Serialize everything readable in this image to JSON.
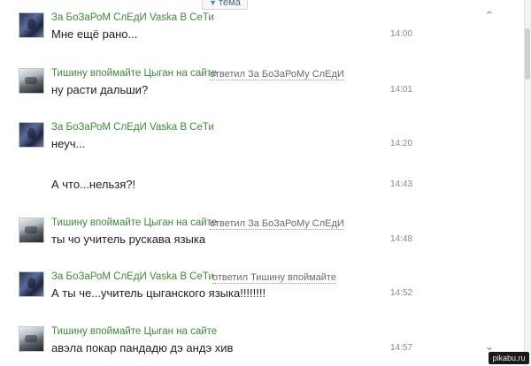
{
  "topic_tab": {
    "label": "тема"
  },
  "messages": [
    {
      "author": "За БоЗаРоМ СлЕдИ Vaѕka В СеТи",
      "reply_label": "",
      "reply_to": "",
      "text": "Мне ещё рано...",
      "time": "14:00",
      "avatar": "a1"
    },
    {
      "author": "Тишину впоймайте Цыган на сайте",
      "reply_label": "ответил",
      "reply_to": "За БоЗаРоМу СлЕдИ",
      "text": "ну расти дальши?",
      "time": "14:01",
      "avatar": "a2"
    },
    {
      "author": "За БоЗаРоМ СлЕдИ Vaѕka В СеТи",
      "reply_label": "",
      "reply_to": "",
      "text": "неуч...",
      "time": "14:20",
      "avatar": "a1"
    },
    {
      "author": "",
      "reply_label": "",
      "reply_to": "",
      "text": "А что...нельзя?!",
      "time": "14:43",
      "avatar": ""
    },
    {
      "author": "Тишину впоймайте Цыган на сайте",
      "reply_label": "ответил",
      "reply_to": "За БоЗаРоМу СлЕдИ",
      "text": "ты чо учитель руcкава языка",
      "time": "14:48",
      "avatar": "a2"
    },
    {
      "author": "За БоЗаРоМ СлЕдИ Vaѕka В СеТи",
      "reply_label": "ответил",
      "reply_to": "Тишину впоймайте",
      "text": "А ты че...учитель цыганского языка!!!!!!!!",
      "time": "14:52",
      "avatar": "a1"
    },
    {
      "author": "Тишину впоймайте Цыган на сайте",
      "reply_label": "",
      "reply_to": "",
      "text": "авэла покар пандадю дэ андэ хив",
      "time": "14:57",
      "avatar": "a2"
    }
  ],
  "footer": {
    "watermark": "pikabu.ru"
  }
}
